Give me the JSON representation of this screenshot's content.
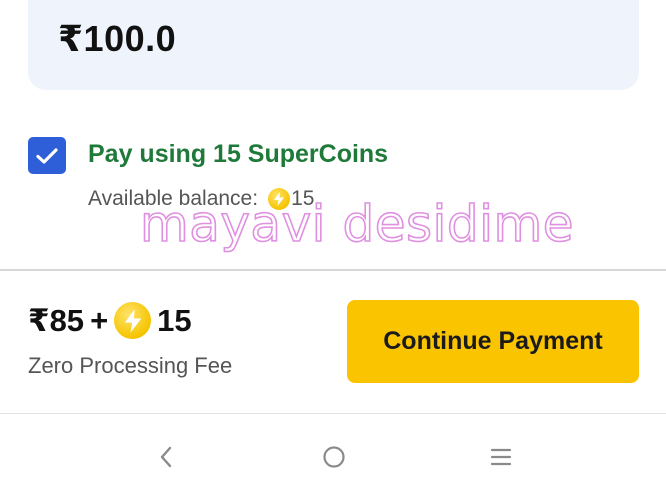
{
  "amount_card": {
    "amount": "₹100.0"
  },
  "supercoins": {
    "checked": true,
    "label": "Pay using 15 SuperCoins",
    "balance_label": "Available balance:",
    "balance_amount": "15",
    "coin_icon": "supercoin-icon"
  },
  "watermark": {
    "text": "mayavi desidime"
  },
  "payment_bar": {
    "rupee_amount": "₹85",
    "plus": "+",
    "coin_amount": "15",
    "fee_text": "Zero Processing Fee",
    "continue_label": "Continue Payment",
    "button_color": "#fbc400"
  },
  "nav": {
    "back_icon": "chevron-left-icon",
    "home_icon": "circle-home-icon",
    "menu_icon": "hamburger-menu-icon"
  },
  "colors": {
    "accent_blue": "#2f5fd8",
    "supercoin_green": "#1f7a3a",
    "card_bg": "#eef3fc"
  }
}
